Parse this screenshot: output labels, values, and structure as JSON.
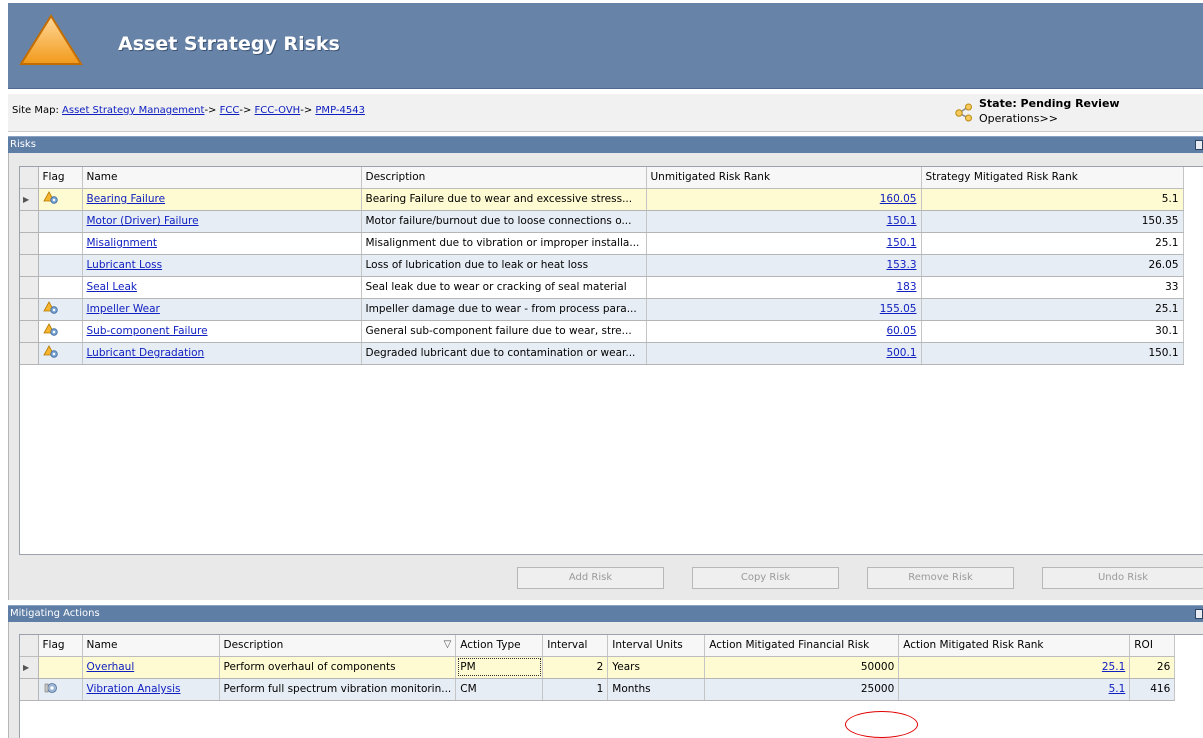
{
  "app": {
    "title": "Asset Strategy Risks"
  },
  "sitemap": {
    "prefix": "Site Map: ",
    "links": [
      "Asset Strategy Management",
      "FCC",
      "FCC-OVH",
      "PMP-4543"
    ],
    "separator": "->"
  },
  "state": {
    "title": "State: Pending Review",
    "link": "Operations>>"
  },
  "risks": {
    "section_title": "Risks",
    "columns": [
      "Flag",
      "Name",
      "Description",
      "Unmitigated Risk Rank",
      "Strategy Mitigated Risk Rank"
    ],
    "rows": [
      {
        "flag": true,
        "name": "Bearing Failure",
        "description": "Bearing Failure due to wear and excessive stress...",
        "unmitigated": "160.05",
        "mitigated": "5.1"
      },
      {
        "flag": false,
        "name": "Motor (Driver) Failure",
        "description": "Motor failure/burnout due to loose connections o...",
        "unmitigated": "150.1",
        "mitigated": "150.35"
      },
      {
        "flag": false,
        "name": "Misalignment",
        "description": "Misalignment due to vibration or improper installa...",
        "unmitigated": "150.1",
        "mitigated": "25.1"
      },
      {
        "flag": false,
        "name": "Lubricant Loss",
        "description": "Loss of lubrication due to leak or heat loss",
        "unmitigated": "153.3",
        "mitigated": "26.05"
      },
      {
        "flag": false,
        "name": "Seal Leak",
        "description": "Seal leak due to wear or cracking of seal material",
        "unmitigated": "183",
        "mitigated": "33"
      },
      {
        "flag": true,
        "name": "Impeller Wear",
        "description": "Impeller damage due to wear - from process para...",
        "unmitigated": "155.05",
        "mitigated": "25.1"
      },
      {
        "flag": true,
        "name": "Sub-component Failure",
        "description": "General sub-component failure due to wear, stre...",
        "unmitigated": "60.05",
        "mitigated": "30.1"
      },
      {
        "flag": true,
        "name": "Lubricant Degradation",
        "description": "Degraded lubricant due to contamination or wear...",
        "unmitigated": "500.1",
        "mitigated": "150.1"
      }
    ],
    "buttons": {
      "add": "Add Risk",
      "copy": "Copy Risk",
      "remove": "Remove Risk",
      "undo": "Undo Risk"
    }
  },
  "actions": {
    "section_title": "Mitigating Actions",
    "columns": [
      "Flag",
      "Name",
      "Description",
      "Action Type",
      "Interval",
      "Interval Units",
      "Action Mitigated Financial Risk",
      "Action Mitigated Risk Rank",
      "ROI"
    ],
    "rows": [
      {
        "flag": false,
        "name": "Overhaul",
        "description": "Perform overhaul of components",
        "type": "PM",
        "interval": "2",
        "units": "Years",
        "financial": "50000",
        "rank": "25.1",
        "roi": "26"
      },
      {
        "flag": true,
        "name": "Vibration Analysis",
        "description": "Perform full spectrum vibration monitorin...",
        "type": "CM",
        "interval": "1",
        "units": "Months",
        "financial": "25000",
        "rank": "5.1",
        "roi": "416"
      }
    ]
  },
  "colors": {
    "banner": "#6883a8",
    "section_bar": "#5f7ea6",
    "selected_row": "#fefbd2",
    "alt_row": "#e7edf5",
    "link": "#1020c0",
    "highlight_ellipse": "#e00000"
  }
}
